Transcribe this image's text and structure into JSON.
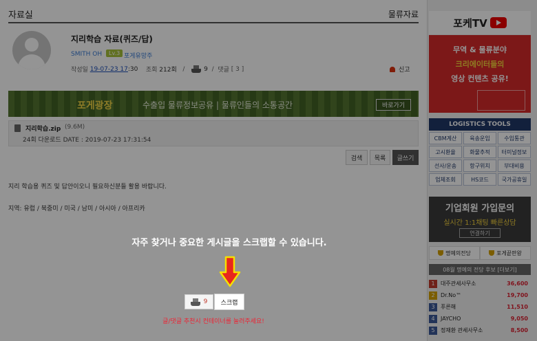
{
  "board": {
    "title": "자료실",
    "category": "물류자료"
  },
  "post": {
    "title": "지리학습 자료(퀴즈/답)",
    "author": "SMITH OH",
    "level": "Lv.3",
    "guild": "포게유망주",
    "date_label": "작성일",
    "date_link": "19-07-23 17",
    "date_rest": ":30",
    "views_label": "조회",
    "views_value": "212회",
    "sep1": "/",
    "recommend_count": "9",
    "sep2": "/",
    "comments_label": "댓글",
    "comments_value": "[ 3 ]",
    "report_label": "신고",
    "body_line1": "지리 학습용 퀴즈 및 답안이오니 필요하신분들 활용 바랍니다.",
    "body_line2": "지역: 유럽 / 북중미 / 미국 / 남미 / 아시아 / 아프리카"
  },
  "banner": {
    "brand": "포게광장",
    "slogan": "수출입 물류정보공유 | 물류인들의 소통공간",
    "button": "바로가기"
  },
  "attachment": {
    "name": "지리학습.zip",
    "size": "(9.6M)",
    "download_info": "24회 다운로드 DATE : 2019-07-23 17:31:54"
  },
  "buttons": {
    "search": "검색",
    "list": "목록",
    "write": "글쓰기",
    "scrap": "스크랩",
    "recommend_count": "9"
  },
  "overlay": {
    "tip": "자주 찾거나 중요한 게시글을 스크랩할 수 있습니다."
  },
  "recommend_msg": "글/댓글 추천시 컨테이너를 눌러주세요!",
  "colors": {
    "overlay_arrow_fill": "#e8271d",
    "overlay_arrow_stroke": "#f5e000",
    "promo_red": "#d62a2a",
    "tools_navy": "#1f3768"
  },
  "sidebar": {
    "tv_label": "포케TV",
    "promo": {
      "line1": "무역 & 물류분야",
      "line2": "크리에이터들의",
      "line3": "영상 컨텐츠 공유!"
    },
    "tools_title": "LOGISTICS TOOLS",
    "tools": [
      "CBM계산",
      "육송운임",
      "수입통관",
      "고시환율",
      "화물추적",
      "터미널정보",
      "선사/운송",
      "항구위치",
      "부대비용",
      "업체조회",
      "HS코드",
      "국가공휴일"
    ],
    "corp": {
      "title": "기업회원 가입문의",
      "subtitle": "실시간 1:1채팅 빠른상담",
      "button": "연결하기"
    },
    "fame_tabs": [
      "명예의전당",
      "포게끝판왕"
    ],
    "fame_title": "08월 명예의 전당 후보 [더보기]",
    "fame": [
      {
        "rank": "1",
        "name": "대주관세사무소",
        "score": "36,600",
        "color": "#c0392b"
      },
      {
        "rank": "2",
        "name": "Dr.No™",
        "score": "19,700",
        "color": "#d4a000"
      },
      {
        "rank": "3",
        "name": "푸른해",
        "score": "11,510",
        "color": "#3b5998"
      },
      {
        "rank": "4",
        "name": "JAYCHO",
        "score": "9,050",
        "color": "#3b5998"
      },
      {
        "rank": "5",
        "name": "정재환 관세사무소",
        "score": "8,500",
        "color": "#3b5998"
      }
    ]
  }
}
